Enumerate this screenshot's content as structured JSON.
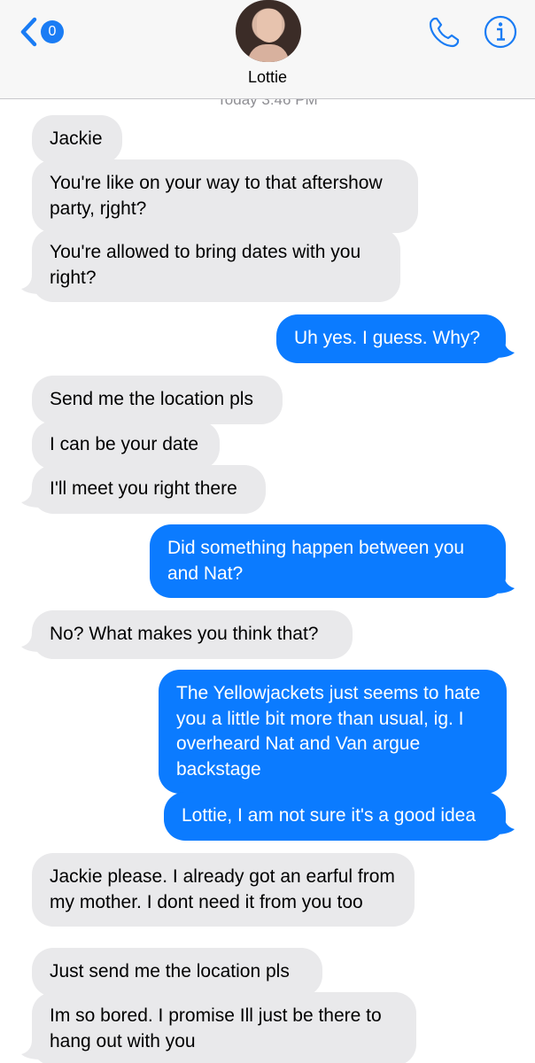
{
  "header": {
    "back_badge_count": "0",
    "contact_name": "Lottie",
    "icons": {
      "back": "chevron-left-icon",
      "call": "phone-icon",
      "info": "info-icon"
    }
  },
  "timestamp": "Today 3:46 PM",
  "colors": {
    "incoming_bubble": "#e9e9eb",
    "outgoing_bubble": "#0b7bff",
    "accent": "#1a7cf4"
  },
  "messages": [
    {
      "from": "them",
      "text": "Jackie"
    },
    {
      "from": "them",
      "text": "You're like on your way to that aftershow party, rjght?"
    },
    {
      "from": "them",
      "text": "You're allowed to bring dates with you right?"
    },
    {
      "from": "me",
      "text": "Uh yes. I guess. Why?"
    },
    {
      "from": "them",
      "text": "Send me the location pls"
    },
    {
      "from": "them",
      "text": "I can be your date"
    },
    {
      "from": "them",
      "text": "I'll meet you right there"
    },
    {
      "from": "me",
      "text": "Did something happen between you and Nat?"
    },
    {
      "from": "them",
      "text": "No? What makes you think that?"
    },
    {
      "from": "me",
      "text": "The Yellowjackets just seems to hate you a little bit more than usual, ig. I overheard Nat and Van argue backstage"
    },
    {
      "from": "me",
      "text": "Lottie, I am not sure it's a good idea"
    },
    {
      "from": "them",
      "text": "Jackie please. I already got an earful from my mother. I dont need it from you too"
    },
    {
      "from": "them",
      "text": "Just send me the location pls"
    },
    {
      "from": "them",
      "text": "Im so bored. I promise Ill just be there to hang out with you"
    }
  ]
}
